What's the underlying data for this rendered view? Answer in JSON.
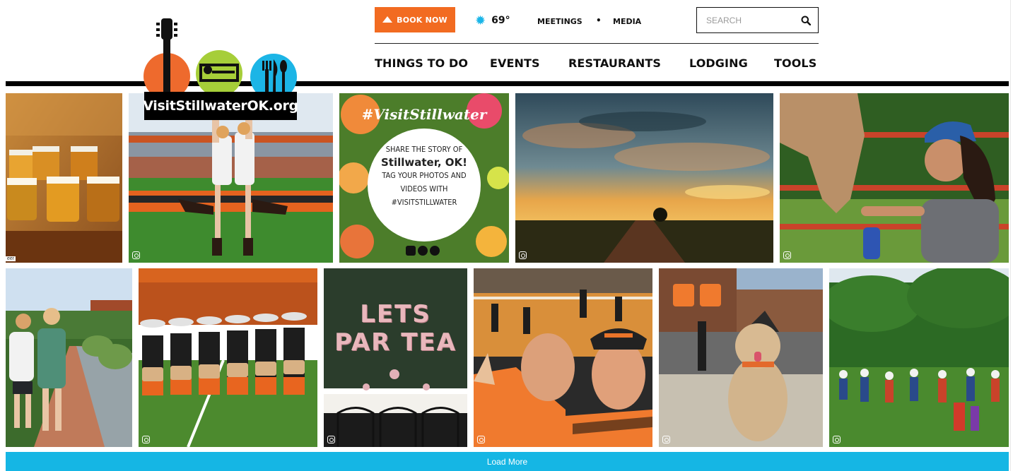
{
  "header": {
    "book_now_label": "BOOK NOW",
    "weather": {
      "icon": "sun-icon",
      "temperature": "69°"
    },
    "links": {
      "meetings": "MEETINGS",
      "separator": "•",
      "media": "MEDIA"
    },
    "search": {
      "placeholder": "SEARCH",
      "value": ""
    },
    "nav": [
      "THINGS TO DO",
      "EVENTS",
      "RESTAURANTS",
      "LODGING",
      "TOOLS"
    ]
  },
  "logo": {
    "text": "VisitStillwaterOK.org",
    "icons": [
      "guitar-icon",
      "bed-icon",
      "fork-knife-spoon-icon"
    ]
  },
  "colors": {
    "accent_orange": "#f26b21",
    "accent_blue": "#15b6e4",
    "logo_green": "#a6ce39",
    "logo_orange": "#ee6a2d",
    "logo_blue": "#1cb5e6"
  },
  "feed": {
    "promo": {
      "hashtag": "#VisitStillwater",
      "line1": "SHARE THE STORY OF",
      "line2": "Stillwater, OK!",
      "line3": "TAG YOUR PHOTOS AND",
      "line4": "VIDEOS WITH",
      "line5": "#VISITSTILLWATER"
    },
    "balloon_text": {
      "line1": "LETS",
      "line2": "PAR TEA"
    },
    "corner_label": "eer",
    "load_more_label": "Load More"
  }
}
